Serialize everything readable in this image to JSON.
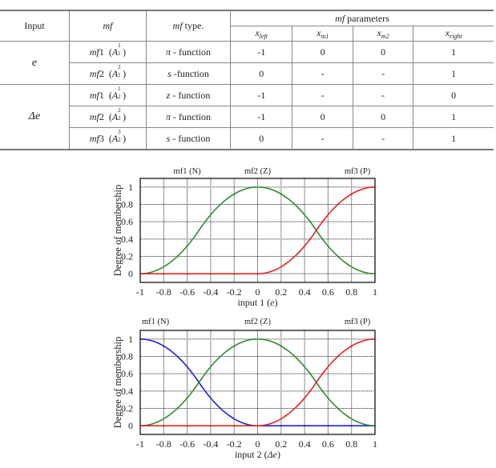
{
  "table": {
    "headers": {
      "input": "Input",
      "mf": "mf",
      "mf_type_italic": "mf",
      "mf_type_rest": " type.",
      "params_italic": "mf",
      "params_rest": " parameters",
      "cols": [
        {
          "base": "x",
          "sub": "left"
        },
        {
          "base": "x",
          "sub": "m1"
        },
        {
          "base": "x",
          "sub": "m2"
        },
        {
          "base": "x",
          "sub": "right"
        }
      ]
    },
    "groups": [
      {
        "input": "e",
        "rows": [
          {
            "mf": "mf",
            "num": "1",
            "A": "A",
            "sup": "1",
            "sub": "1",
            "type_sym": "π",
            "type_rest": " - function",
            "x_left": "-1",
            "x_m1": "0",
            "x_m2": "0",
            "x_right": "1"
          },
          {
            "mf": "mf",
            "num": "2",
            "A": "A",
            "sup": "2",
            "sub": "1",
            "type_sym": "s",
            "type_rest": " -function",
            "x_left": "0",
            "x_m1": "-",
            "x_m2": "-",
            "x_right": "1"
          }
        ]
      },
      {
        "input": "Δe",
        "rows": [
          {
            "mf": "mf",
            "num": "1",
            "A": "A",
            "sup": "1",
            "sub": "2",
            "type_sym": "z",
            "type_rest": " - function",
            "x_left": "-1",
            "x_m1": "-",
            "x_m2": "-",
            "x_right": "0"
          },
          {
            "mf": "mf",
            "num": "2",
            "A": "A",
            "sup": "2",
            "sub": "2",
            "type_sym": "π",
            "type_rest": " - function",
            "x_left": "-1",
            "x_m1": "0",
            "x_m2": "0",
            "x_right": "1"
          },
          {
            "mf": "mf",
            "num": "3",
            "A": "A",
            "sup": "3",
            "sub": "2",
            "type_sym": "s",
            "type_rest": " - function",
            "x_left": "0",
            "x_m1": "-",
            "x_m2": "-",
            "x_right": "1"
          }
        ]
      }
    ]
  },
  "chart_data": [
    {
      "type": "line",
      "title": "",
      "xlabel_prefix": "input 1 (",
      "xlabel_var": "e",
      "xlabel_suffix": ")",
      "ylabel": "Degree of membership",
      "xlim": [
        -1,
        1
      ],
      "ylim": [
        0,
        1
      ],
      "xticks": [
        "-1",
        "-0.8",
        "-0.6",
        "-0.4",
        "-0.2",
        "0",
        "0.2",
        "0.4",
        "0.6",
        "0.8",
        "1"
      ],
      "yticks": [
        "0",
        "0.2",
        "0.4",
        "0.6",
        "0.8",
        "1"
      ],
      "grid": true,
      "annotations": [
        {
          "text": "mf1 (N)",
          "x": -0.6
        },
        {
          "text": "mf2 (Z)",
          "x": 0
        },
        {
          "text": "mf3 (P)",
          "x": 0.85
        }
      ],
      "series": [
        {
          "name": "mf2 (Z)",
          "function": "pi",
          "params": [
            -1,
            0,
            0,
            1
          ],
          "color": "#2e8b2e",
          "x": [
            -1,
            -0.8,
            -0.6,
            -0.4,
            -0.2,
            0,
            0.2,
            0.4,
            0.6,
            0.8,
            1
          ],
          "y": [
            0,
            0.09,
            0.33,
            0.67,
            0.91,
            1,
            0.91,
            0.67,
            0.33,
            0.09,
            0
          ]
        },
        {
          "name": "mf3 (P)",
          "function": "s",
          "params": [
            0,
            1
          ],
          "color": "#e8231f",
          "x": [
            -1,
            -0.8,
            -0.6,
            -0.4,
            -0.2,
            0,
            0.2,
            0.4,
            0.6,
            0.8,
            1
          ],
          "y": [
            0,
            0,
            0,
            0,
            0,
            0,
            0.09,
            0.33,
            0.67,
            0.91,
            1
          ]
        }
      ]
    },
    {
      "type": "line",
      "title": "",
      "xlabel_prefix": "input 2 (",
      "xlabel_var": "Δe",
      "xlabel_suffix": ")",
      "ylabel": "Degree of membership",
      "xlim": [
        -1,
        1
      ],
      "ylim": [
        0,
        1
      ],
      "xticks": [
        "-1",
        "-0.8",
        "-0.6",
        "-0.4",
        "-0.2",
        "0",
        "0.2",
        "0.4",
        "0.6",
        "0.8",
        "1"
      ],
      "yticks": [
        "0",
        "0.2",
        "0.4",
        "0.6",
        "0.8",
        "1"
      ],
      "grid": true,
      "annotations": [
        {
          "text": "mf1 (N)",
          "x": -0.87
        },
        {
          "text": "mf2 (Z)",
          "x": 0
        },
        {
          "text": "mf3 (P)",
          "x": 0.85
        }
      ],
      "series": [
        {
          "name": "mf1 (N)",
          "function": "z",
          "params": [
            -1,
            0
          ],
          "color": "#1f1fe0",
          "x": [
            -1,
            -0.8,
            -0.6,
            -0.4,
            -0.2,
            0,
            0.2,
            0.4,
            0.6,
            0.8,
            1
          ],
          "y": [
            1,
            0.91,
            0.67,
            0.33,
            0.09,
            0,
            0,
            0,
            0,
            0,
            0
          ]
        },
        {
          "name": "mf2 (Z)",
          "function": "pi",
          "params": [
            -1,
            0,
            0,
            1
          ],
          "color": "#2e8b2e",
          "x": [
            -1,
            -0.8,
            -0.6,
            -0.4,
            -0.2,
            0,
            0.2,
            0.4,
            0.6,
            0.8,
            1
          ],
          "y": [
            0,
            0.09,
            0.33,
            0.67,
            0.91,
            1,
            0.91,
            0.67,
            0.33,
            0.09,
            0
          ]
        },
        {
          "name": "mf3 (P)",
          "function": "s",
          "params": [
            0,
            1
          ],
          "color": "#e8231f",
          "x": [
            -1,
            -0.8,
            -0.6,
            -0.4,
            -0.2,
            0,
            0.2,
            0.4,
            0.6,
            0.8,
            1
          ],
          "y": [
            0,
            0,
            0,
            0,
            0,
            0,
            0.09,
            0.33,
            0.67,
            0.91,
            1
          ]
        }
      ]
    }
  ]
}
